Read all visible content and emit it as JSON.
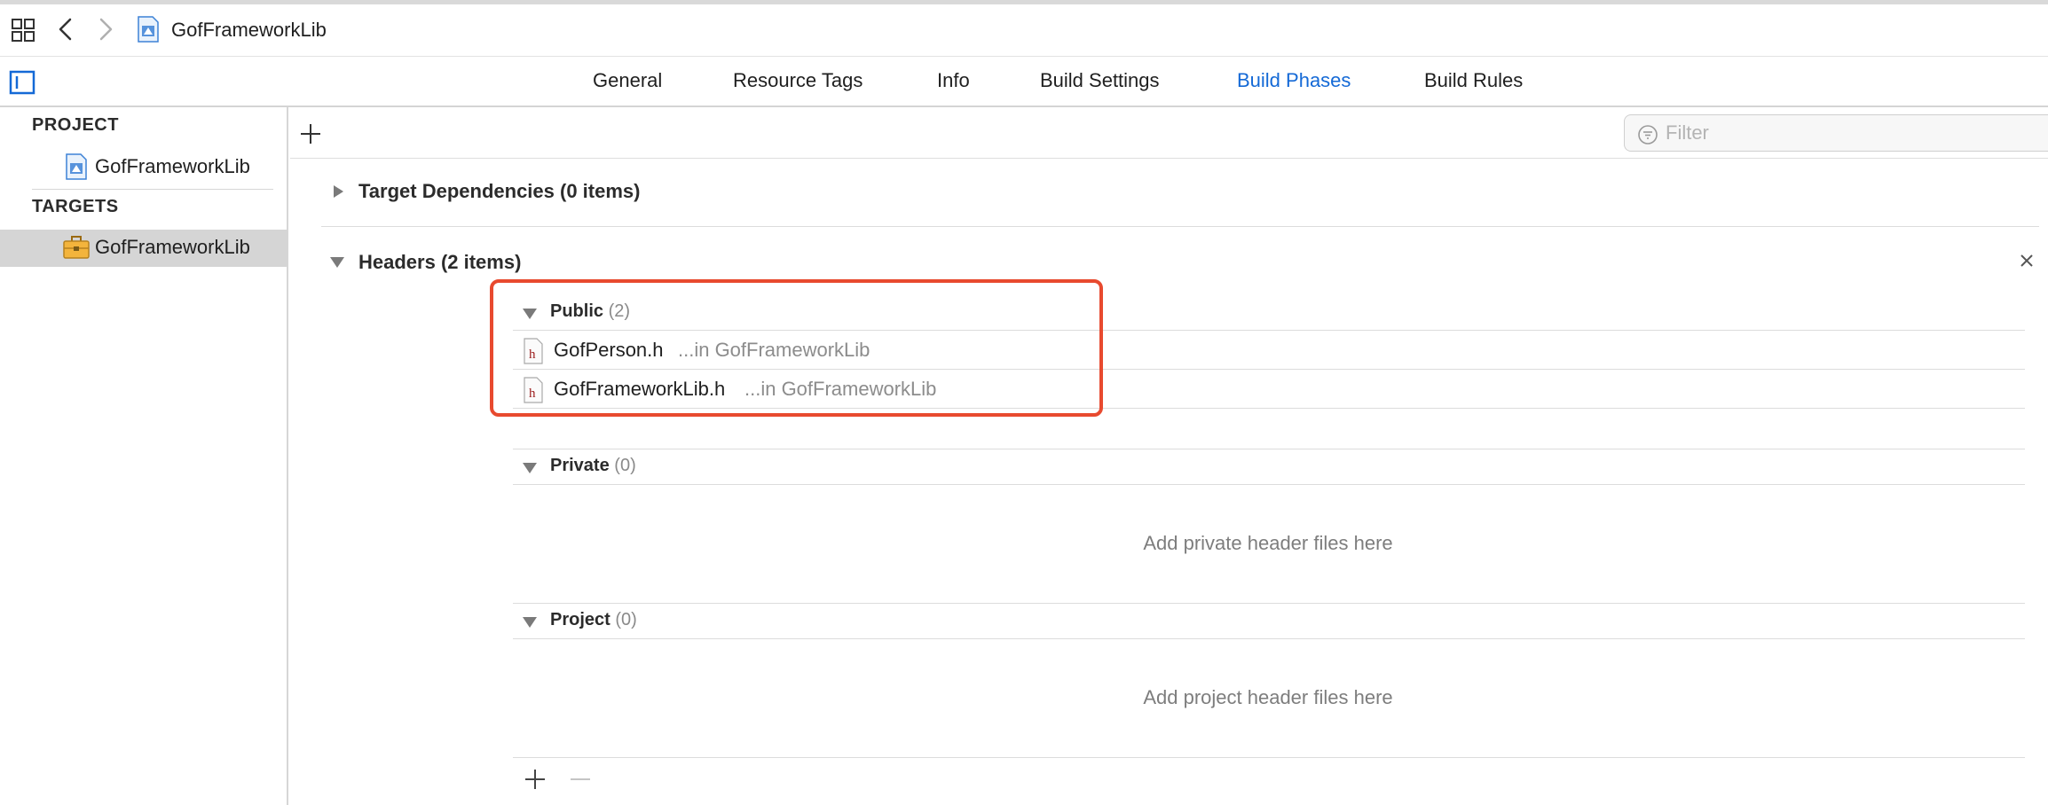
{
  "pathbar": {
    "breadcrumb": "GofFrameworkLib",
    "icons": {
      "grid": "grid-icon",
      "back": "chevron-left-icon",
      "forward": "chevron-right-icon",
      "project": "xcode-project-icon"
    }
  },
  "tabs": [
    {
      "label": "General",
      "active": false
    },
    {
      "label": "Resource Tags",
      "active": false
    },
    {
      "label": "Info",
      "active": false
    },
    {
      "label": "Build Settings",
      "active": false
    },
    {
      "label": "Build Phases",
      "active": true
    },
    {
      "label": "Build Rules",
      "active": false
    }
  ],
  "sidebar": {
    "project_header": "PROJECT",
    "project_item": "GofFrameworkLib",
    "targets_header": "TARGETS",
    "target_item": "GofFrameworkLib"
  },
  "toolbar": {
    "filter_placeholder": "Filter"
  },
  "phases": {
    "target_dependencies": "Target Dependencies (0 items)",
    "headers": "Headers (2 items)"
  },
  "headers": {
    "public": {
      "title": "Public",
      "count": "(2)"
    },
    "files": [
      {
        "name": "GofPerson.h",
        "location": "...in GofFrameworkLib"
      },
      {
        "name": "GofFrameworkLib.h",
        "location": "...in GofFrameworkLib"
      }
    ],
    "private": {
      "title": "Private",
      "count": "(0)",
      "empty": "Add private header files here"
    },
    "project": {
      "title": "Project",
      "count": "(0)",
      "empty": "Add project header files here"
    }
  },
  "colors": {
    "accent": "#1469d6",
    "highlight": "#e84a2f",
    "selection": "#d5d5d5"
  }
}
